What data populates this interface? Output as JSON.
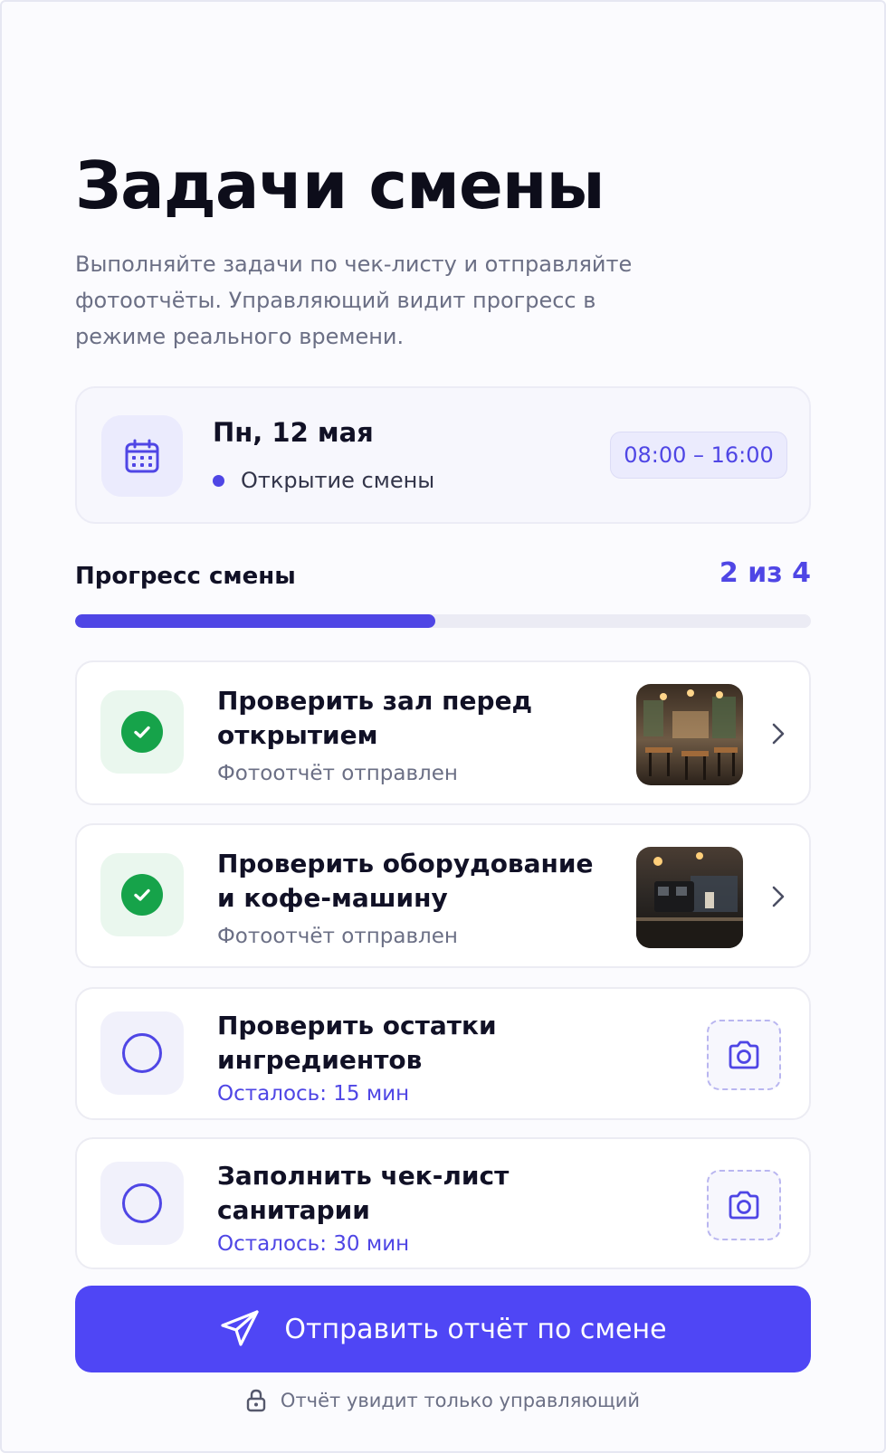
{
  "header": {
    "title": "Задачи смены",
    "subtitle": "Выполняйте задачи по чек-листу и отправляйте фотоотчёты. Управляющий видит прогресс в режиме реального времени."
  },
  "shift": {
    "date": "Пн, 12 мая",
    "status": "Открытие смены",
    "time": "08:00 – 16:00",
    "icon": "calendar-icon"
  },
  "progress": {
    "label": "Прогресс смены",
    "count_text": "2 из 4",
    "done": 2,
    "total": 4,
    "fraction": 0.5
  },
  "tasks": [
    {
      "title": "Проверить зал перед открытием",
      "subtitle": "Фотоотчёт отправлен",
      "done": true,
      "thumb": "cafe-hall-photo"
    },
    {
      "title": "Проверить оборудование и кофе-машину",
      "subtitle": "Фотоотчёт отправлен",
      "done": true,
      "thumb": "coffee-machine-photo"
    },
    {
      "title": "Проверить остатки ингредиентов",
      "subtitle": "Осталось: 15 мин",
      "done": false,
      "action_icon": "camera-icon"
    },
    {
      "title": "Заполнить чек-лист санитарии",
      "subtitle": "Осталось: 30 мин",
      "done": false,
      "action_icon": "camera-icon"
    }
  ],
  "actions": {
    "send_label": "Отправить отчёт по смене",
    "footnote": "Отчёт увидит только управляющий"
  },
  "colors": {
    "accent": "#4f46e5",
    "success": "#16a34a",
    "text_muted": "#6b6f85"
  }
}
